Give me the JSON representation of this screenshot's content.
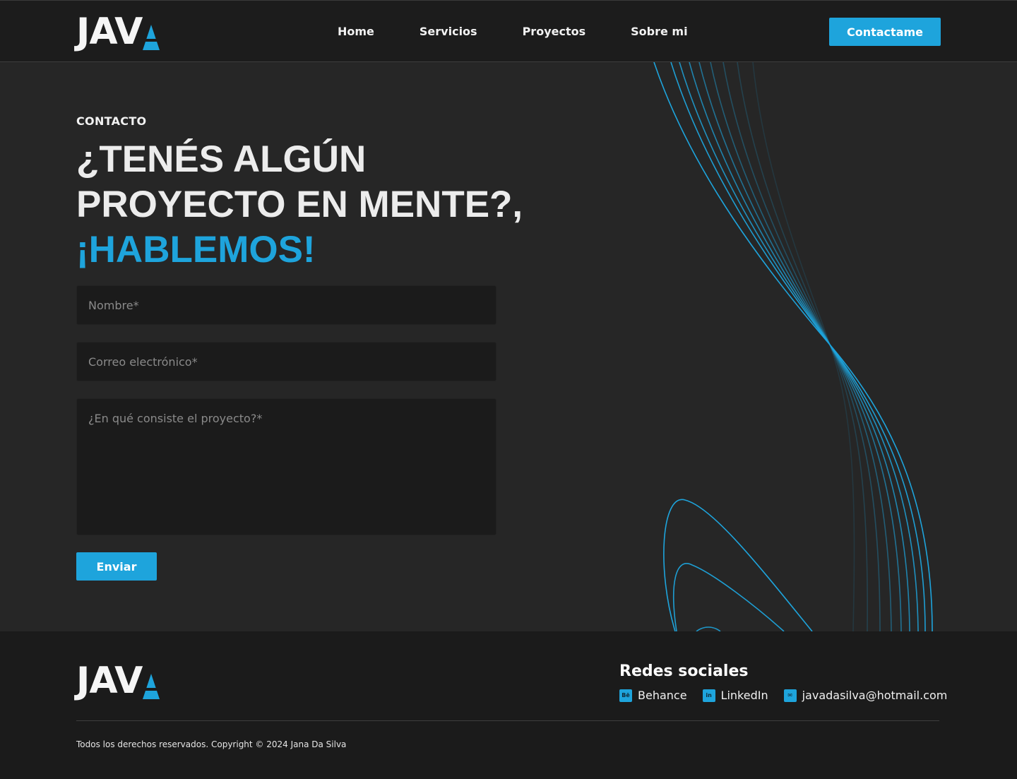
{
  "brand": {
    "logo_text": "JAV",
    "accent_color": "#1ea4dc"
  },
  "nav": {
    "items": [
      {
        "label": "Home"
      },
      {
        "label": "Servicios"
      },
      {
        "label": "Proyectos"
      },
      {
        "label": "Sobre mi"
      }
    ],
    "cta_label": "Contactame"
  },
  "contact": {
    "eyebrow": "CONTACTO",
    "headline_line1": "¿TENÉS ALGÚN",
    "headline_line2": "PROYECTO EN MENTE?,",
    "headline_accent": "¡HABLEMOS!",
    "form": {
      "name_placeholder": "Nombre*",
      "email_placeholder": "Correo electrónico*",
      "message_placeholder": "¿En qué consiste el proyecto?*",
      "submit_label": "Enviar"
    }
  },
  "footer": {
    "social_title": "Redes sociales",
    "links": [
      {
        "icon": "behance-icon",
        "icon_glyph": "Bē",
        "label": "Behance"
      },
      {
        "icon": "linkedin-icon",
        "icon_glyph": "in",
        "label": "LinkedIn"
      },
      {
        "icon": "mail-icon",
        "icon_glyph": "✉",
        "label": "javadasilva@hotmail.com"
      }
    ],
    "copyright": "Todos los derechos reservados. Copyright © 2024 Jana Da Silva"
  }
}
